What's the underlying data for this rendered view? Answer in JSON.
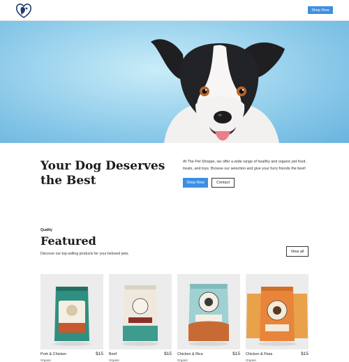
{
  "header": {
    "cta_label": "Shop Now"
  },
  "intro": {
    "title": "Your Dog Deserves the Best",
    "text": "At The Pet Shoppe, we offer a wide range of healthy and organic pet food, treats, and toys. Browse our selection and give your furry friends the best!",
    "shop_label": "Shop Now",
    "contact_label": "Contact"
  },
  "featured": {
    "eyebrow": "Quality",
    "title": "Featured",
    "description": "Discover our top-selling products for your beloved pets.",
    "view_all_label": "View all",
    "products": [
      {
        "name": "Pork & Chicken",
        "tag": "Organic",
        "price": "$15",
        "pack_brand": "GREEN PAW",
        "pack_flavor": "PORK & CHICKEN",
        "color": "#2f8f80"
      },
      {
        "name": "Beef",
        "tag": "Organic",
        "price": "$15",
        "pack_brand": "GREEN PAW",
        "pack_flavor": "BEEF",
        "color": "#3d9c8e"
      },
      {
        "name": "Chicken & Rice",
        "tag": "Organic",
        "price": "$15",
        "pack_brand": "GREEN PAW ORGANICS",
        "pack_flavor": "CHICKEN & RICE",
        "color": "#9fd0d2"
      },
      {
        "name": "Chicken & Peas",
        "tag": "Organic",
        "price": "$15",
        "pack_brand": "",
        "pack_flavor": "",
        "color": "#e8853a"
      }
    ]
  },
  "colors": {
    "accent": "#3f8fe0",
    "hero_bg": "#a6d9f0"
  }
}
